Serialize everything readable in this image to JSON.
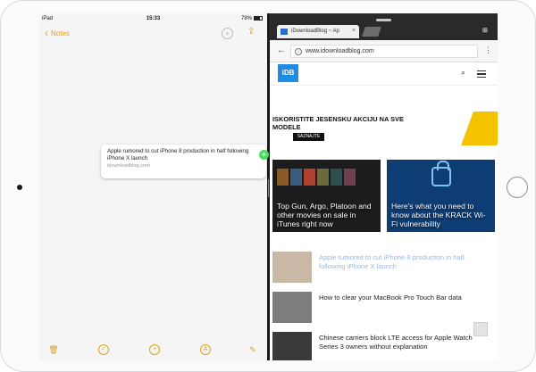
{
  "status_bar": {
    "carrier": "iPad",
    "time": "15:33",
    "battery": "78%"
  },
  "notes": {
    "back_label": "Notes",
    "drag_card": {
      "title": "Apple rumored to cut iPhone 8 production in half following iPhone X launch",
      "source": "idownloadblog.com"
    },
    "toolbar": {
      "checklist_icon": "checklist",
      "add_icon": "plus",
      "draw_icon": "pen",
      "compose_icon": "compose"
    }
  },
  "browser": {
    "tab_title": "iDownloadBlog ~ Ap",
    "url": "www.idownloadblog.com",
    "logo_text": "iDB",
    "ad": {
      "headline": "ISKORISTITE JESENSKU AKCIJU NA SVE MODELE",
      "button": "SAZNAJTE VIŠE"
    },
    "features": [
      {
        "title": "Top Gun, Argo, Platoon and other movies on sale in iTunes right now",
        "bg": "#1c1c1f"
      },
      {
        "title": "Here's what you need to know about the KRACK Wi-Fi vulnerability",
        "bg": "#0e3d74"
      }
    ],
    "articles": [
      {
        "title": "Apple rumored to cut iPhone 8 production in half following iPhone X launch",
        "faded": true
      },
      {
        "title": "How to clear your MacBook Pro Touch Bar data",
        "faded": false
      },
      {
        "title": "Chinese carriers block LTE access for Apple Watch Series 3 owners without explanation",
        "faded": false
      }
    ]
  },
  "colors": {
    "accent": "#e0a21a",
    "link": "#1e8be5",
    "drop_badge": "#4cd964",
    "ad_yellow": "#f4c300"
  }
}
